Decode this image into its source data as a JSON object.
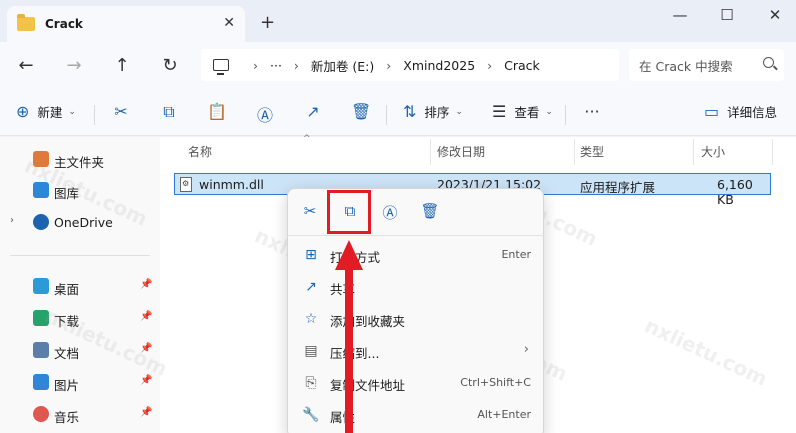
{
  "tab": {
    "title": "Crack",
    "close": "✕"
  },
  "window": {
    "new_tab": "+",
    "minimize": "—",
    "maximize": "☐",
    "close": "✕"
  },
  "nav": {
    "back": "←",
    "forward": "→",
    "up": "↑",
    "refresh": "↻"
  },
  "address": {
    "more": "···",
    "sep": "›",
    "crumbs": [
      "新加卷 (E:)",
      "Xmind2025",
      "Crack"
    ]
  },
  "search": {
    "placeholder": "在 Crack 中搜索"
  },
  "commandbar": {
    "new_label": "新建",
    "sort_label": "排序",
    "view_label": "查看",
    "more": "···",
    "details_label": "详细信息"
  },
  "sidebar": {
    "top": [
      {
        "label": "主文件夹",
        "color": "#e07a3a"
      },
      {
        "label": "图库",
        "color": "#2b88d8"
      },
      {
        "label": "OneDrive",
        "color": "#1e63b0",
        "expandable": "›"
      }
    ],
    "pinned": [
      {
        "label": "桌面",
        "color": "#2a9bd8"
      },
      {
        "label": "下载",
        "color": "#25a36b"
      },
      {
        "label": "文档",
        "color": "#5b7fa8"
      },
      {
        "label": "图片",
        "color": "#2f86d6"
      },
      {
        "label": "音乐",
        "color": "#e0574f"
      }
    ],
    "pin_glyph": "📌"
  },
  "columns": {
    "name": "名称",
    "modified": "修改日期",
    "type": "类型",
    "size": "大小",
    "sort_glyph": "^"
  },
  "file": {
    "name": "winmm.dll",
    "modified": "2023/1/21 15:02",
    "type": "应用程序扩展",
    "size": "6,160 KB"
  },
  "context_menu": {
    "items": [
      {
        "label": "打开方式",
        "shortcut": "Enter"
      },
      {
        "label": "共享",
        "shortcut": ""
      },
      {
        "label": "添加到收藏夹",
        "shortcut": ""
      },
      {
        "label": "压缩到...",
        "shortcut": "",
        "submenu": "›"
      },
      {
        "label": "复制文件地址",
        "shortcut": "Ctrl+Shift+C"
      },
      {
        "label": "属性",
        "shortcut": "Alt+Enter"
      }
    ]
  },
  "colors": {
    "accent": "#1e63b0",
    "highlight_red": "#e21c24",
    "selection": "#cce4f7"
  }
}
